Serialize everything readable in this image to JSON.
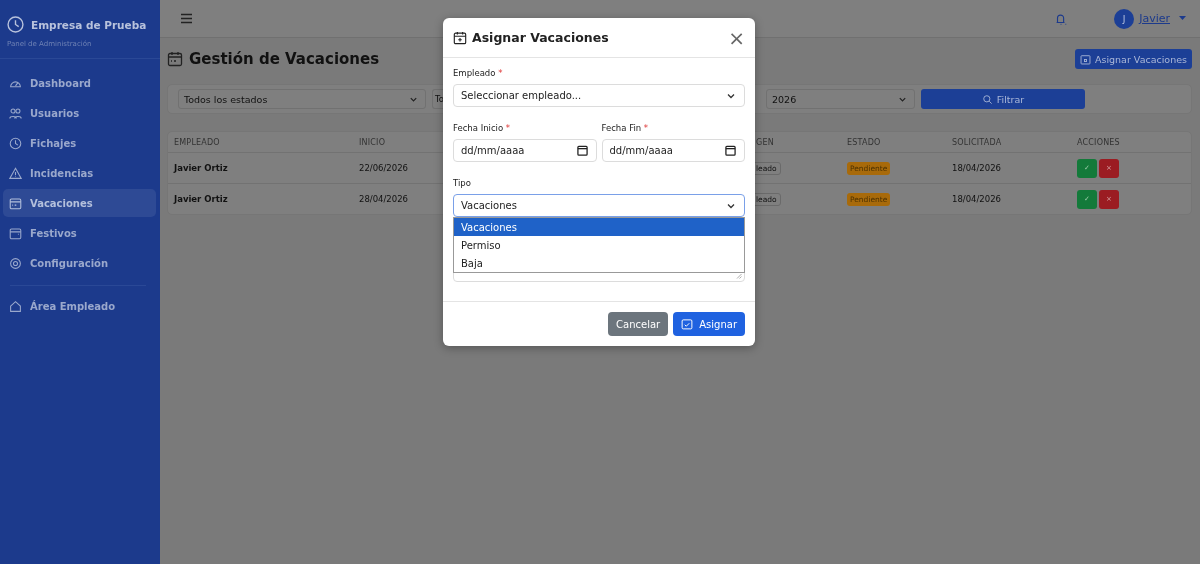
{
  "sidebar": {
    "brand": "Empresa de Prueba",
    "subtitle": "Panel de Administración",
    "items": [
      {
        "label": "Dashboard",
        "selected": false
      },
      {
        "label": "Usuarios",
        "selected": false
      },
      {
        "label": "Fichajes",
        "selected": false
      },
      {
        "label": "Incidencias",
        "selected": false
      },
      {
        "label": "Vacaciones",
        "selected": true
      },
      {
        "label": "Festivos",
        "selected": false
      },
      {
        "label": "Configuración",
        "selected": false
      }
    ],
    "footer_item": {
      "label": "Área Empleado"
    }
  },
  "topbar": {
    "user_initial": "J",
    "user_name": "Javier"
  },
  "page": {
    "title": "Gestión de Vacaciones",
    "action_button": "Asignar Vacaciones"
  },
  "filters": [
    {
      "value": "Todos los estados"
    },
    {
      "value": "To"
    },
    {
      "value": "2026"
    }
  ],
  "filter_button": "Filtrar",
  "table": {
    "columns": [
      "EMPLEADO",
      "INICIO",
      "GEN",
      "ESTADO",
      "SOLICITADA",
      "ACCIONES"
    ],
    "rows": [
      {
        "empleado": "Javier Ortiz",
        "inicio": "22/06/2026",
        "column_3": "leado",
        "estado": "Pendiente",
        "solicitada": "18/04/2026",
        "approve": "✓",
        "reject": "×"
      },
      {
        "empleado": "Javier Ortiz",
        "inicio": "28/04/2026",
        "column_3": "leado",
        "estado": "Pendiente",
        "solicitada": "18/04/2026",
        "approve": "✓",
        "reject": "×"
      }
    ]
  },
  "modal": {
    "title": "Asignar Vacaciones",
    "close": "×",
    "fields": [
      {
        "kind": "select",
        "label": "Empleado",
        "required_mark": "*",
        "value": "Seleccionar empleado..."
      },
      {
        "kind": "date",
        "label": "Fecha Inicio",
        "required_mark": "*",
        "placeholder": "dd/mm/aaaa"
      },
      {
        "kind": "date",
        "label": "Fecha Fin",
        "required_mark": "*",
        "placeholder": "dd/mm/aaaa"
      },
      {
        "kind": "select",
        "label": "Tipo",
        "value": "Vacaciones",
        "expanded": true,
        "options": [
          {
            "label": "Vacaciones",
            "selected": true
          },
          {
            "label": "Permiso",
            "selected": false
          },
          {
            "label": "Baja",
            "selected": false
          }
        ]
      },
      {
        "kind": "textarea"
      }
    ],
    "buttons": [
      {
        "kind": "secondary",
        "label": "Cancelar"
      },
      {
        "kind": "primary",
        "label": "Asignar"
      }
    ]
  }
}
